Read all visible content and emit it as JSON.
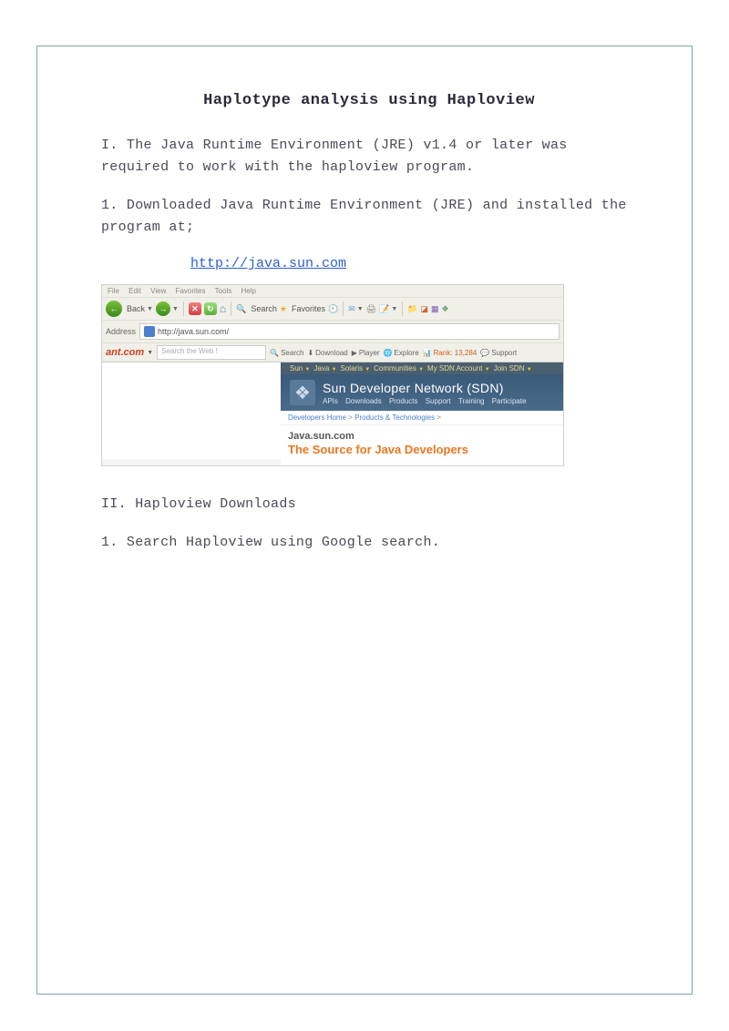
{
  "document": {
    "title": "Haplotype analysis using Haploview",
    "section_I": "I. The Java Runtime Environment (JRE) v1.4 or later was required to work with the haploview program.",
    "step_I_1": "1. Downloaded Java Runtime Environment (JRE)  and installed the program at;",
    "link_java": "http://java.sun.com",
    "section_II": "II. Haploview Downloads",
    "step_II_1": "1. Search Haploview using Google search."
  },
  "browser": {
    "menus": [
      "File",
      "Edit",
      "View",
      "Favorites",
      "Tools",
      "Help"
    ],
    "back": "Back",
    "search": "Search",
    "favorites": "Favorites",
    "address_label": "Address",
    "address_value": "http://java.sun.com/",
    "ant_logo": "ant.com",
    "ant_placeholder": "Search the Web !",
    "ant_items": {
      "search": "Search",
      "download": "Download",
      "player": "Player",
      "explore": "Explore",
      "rank": "Rank: 13,284",
      "support": "Support"
    },
    "sun_nav": [
      "Sun",
      "Java",
      "Solaris",
      "Communities",
      "My SDN Account",
      "Join SDN"
    ],
    "sun_brand": "Sun",
    "sdn_title": "Sun Developer Network (SDN)",
    "sdn_links": [
      "APIs",
      "Downloads",
      "Products",
      "Support",
      "Training",
      "Participate"
    ],
    "crumb_home": "Developers Home",
    "crumb_sep": " > ",
    "crumb_prod": "Products & Technologies",
    "crumb_end": " >",
    "java_label": "Java.sun.com",
    "java_tagline": "The Source for Java Developers"
  }
}
